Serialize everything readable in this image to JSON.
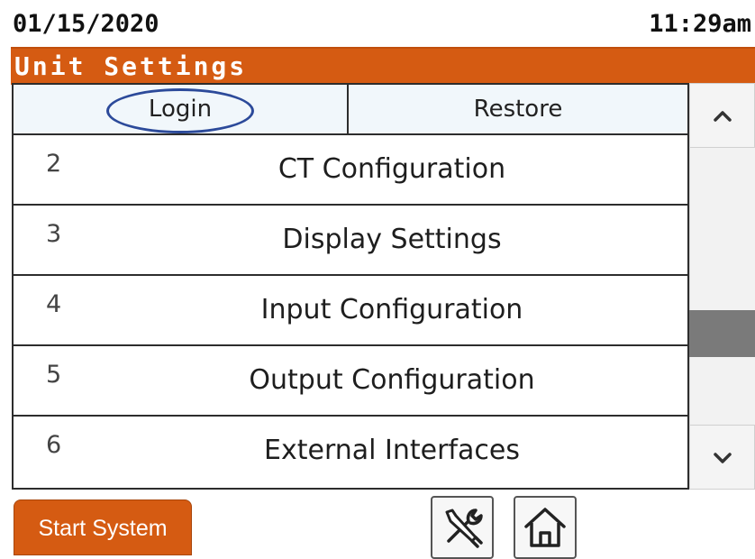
{
  "status": {
    "date": "01/15/2020",
    "time": "11:29am"
  },
  "header": {
    "title": "Unit Settings"
  },
  "tabs": {
    "login": "Login",
    "restore": "Restore"
  },
  "menu": [
    {
      "num": "2",
      "label": "CT Configuration"
    },
    {
      "num": "3",
      "label": "Display Settings"
    },
    {
      "num": "4",
      "label": "Input Configuration"
    },
    {
      "num": "5",
      "label": "Output Configuration"
    },
    {
      "num": "6",
      "label": "External Interfaces"
    }
  ],
  "footer": {
    "start_label": "Start System"
  },
  "icons": {
    "up": "chevron-up-icon",
    "down": "chevron-down-icon",
    "tools": "tools-icon",
    "home": "home-icon"
  },
  "colors": {
    "accent": "#d55b12",
    "highlight_oval": "#2c4a9a",
    "header_row_bg": "#f1f7fb",
    "scroll_thumb": "#7a7a7a"
  }
}
